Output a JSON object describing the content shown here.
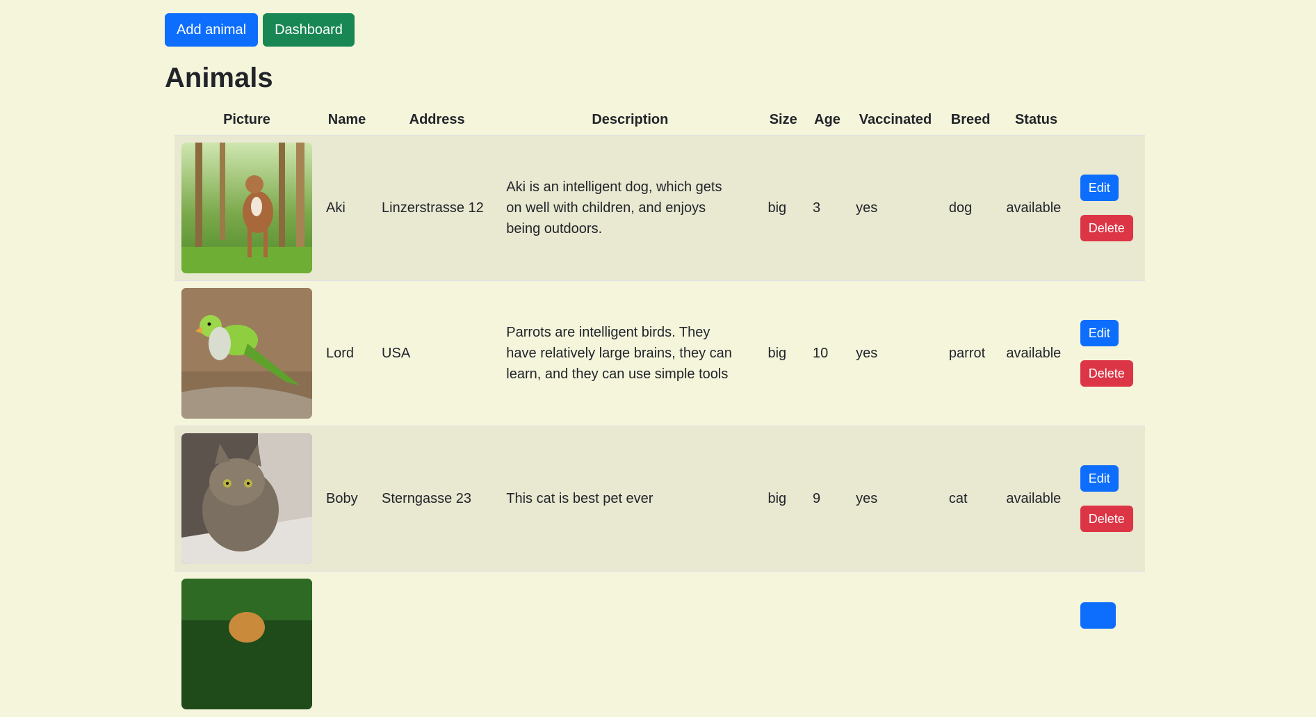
{
  "toolbar": {
    "add_label": "Add animal",
    "dashboard_label": "Dashboard"
  },
  "page": {
    "title": "Animals"
  },
  "table": {
    "headers": [
      "Picture",
      "Name",
      "Address",
      "Description",
      "Size",
      "Age",
      "Vaccinated",
      "Breed",
      "Status",
      ""
    ],
    "rows": [
      {
        "picture": "dog-photo",
        "name": "Aki",
        "address": "Linzerstrasse 12",
        "description": "Aki is an intelligent dog, which gets on well with children, and enjoys being outdoors.",
        "size": "big",
        "age": "3",
        "vaccinated": "yes",
        "breed": "dog",
        "status": "available",
        "edit_label": "Edit",
        "delete_label": "Delete"
      },
      {
        "picture": "parrot-photo",
        "name": "Lord",
        "address": "USA",
        "description": "Parrots are intelligent birds. They have relatively large brains, they can learn, and they can use simple tools",
        "size": "big",
        "age": "10",
        "vaccinated": "yes",
        "breed": "parrot",
        "status": "available",
        "edit_label": "Edit",
        "delete_label": "Delete"
      },
      {
        "picture": "cat-photo",
        "name": "Boby",
        "address": "Sterngasse 23",
        "description": "This cat is best pet ever",
        "size": "big",
        "age": "9",
        "vaccinated": "yes",
        "breed": "cat",
        "status": "available",
        "edit_label": "Edit",
        "delete_label": "Delete"
      },
      {
        "picture": "dog-photo-2",
        "name": "",
        "address": "",
        "description": "",
        "size": "",
        "age": "",
        "vaccinated": "",
        "breed": "",
        "status": "",
        "edit_label": "",
        "delete_label": ""
      }
    ]
  },
  "colors": {
    "background": "#f5f5dc",
    "stripe": "#e9e8d1",
    "primary": "#0d6efd",
    "success": "#198754",
    "danger": "#dc3545"
  }
}
